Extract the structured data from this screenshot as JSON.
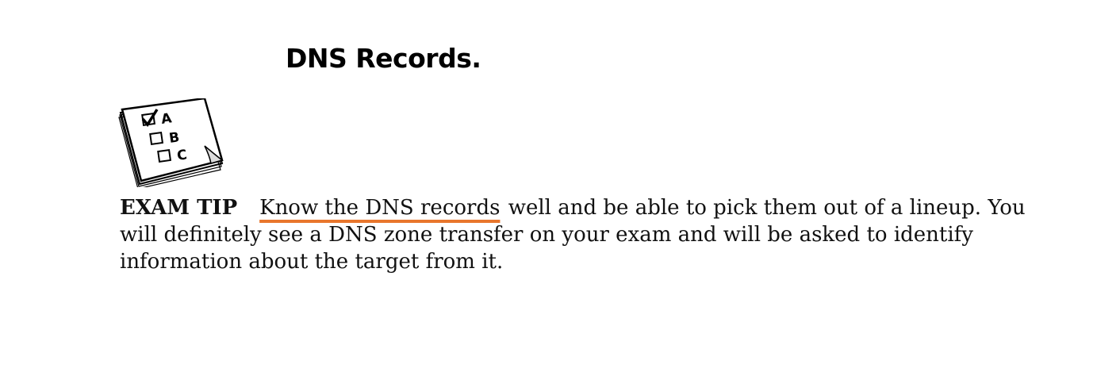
{
  "page": {
    "title": "DNS Records."
  },
  "exam_tip": {
    "label": "EXAM TIP",
    "highlighted_text": "Know the DNS records",
    "body_text": " well and be able to pick them out of a lineup. You will definitely see a DNS zone transfer on your exam and will be asked to identify information about the target from it.",
    "options": [
      "A",
      "B",
      "C"
    ]
  },
  "colors": {
    "underline": "#e8762c",
    "text": "#111111"
  }
}
